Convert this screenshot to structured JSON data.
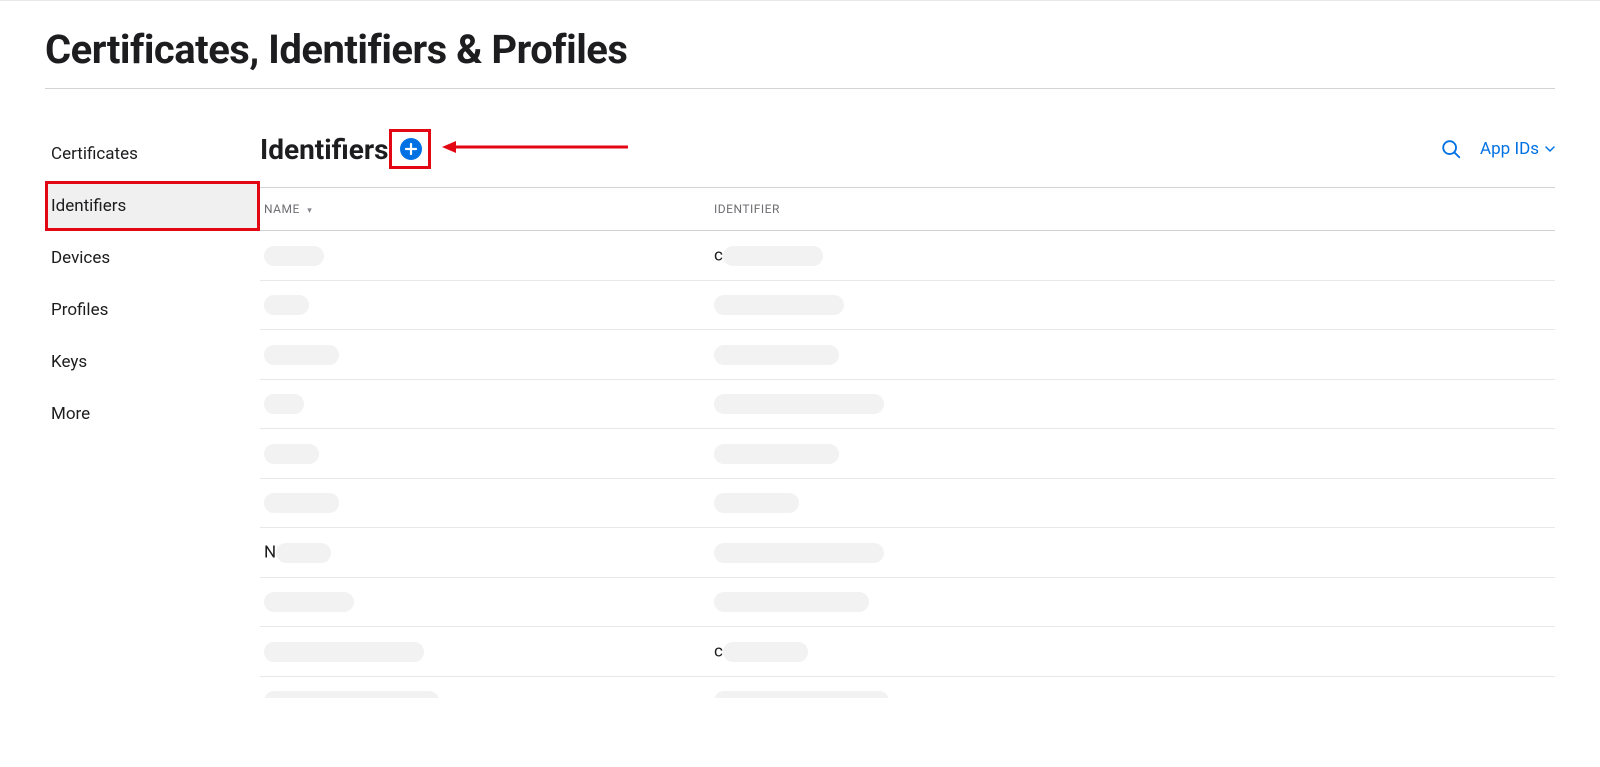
{
  "page_title": "Certificates, Identifiers & Profiles",
  "sidebar": {
    "items": [
      {
        "label": "Certificates",
        "active": false
      },
      {
        "label": "Identifiers",
        "active": true
      },
      {
        "label": "Devices",
        "active": false
      },
      {
        "label": "Profiles",
        "active": false
      },
      {
        "label": "Keys",
        "active": false
      },
      {
        "label": "More",
        "active": false
      }
    ]
  },
  "main": {
    "title": "Identifiers",
    "filter_label": "App IDs",
    "columns": {
      "name": "NAME",
      "identifier": "IDENTIFIER"
    },
    "rows": [
      {
        "name_prefix": "",
        "name_width": 60,
        "id_prefix": "c",
        "id_width": 100
      },
      {
        "name_prefix": "",
        "name_width": 45,
        "id_prefix": "",
        "id_width": 130
      },
      {
        "name_prefix": "",
        "name_width": 75,
        "id_prefix": "",
        "id_width": 125
      },
      {
        "name_prefix": "",
        "name_width": 40,
        "id_prefix": "",
        "id_width": 170
      },
      {
        "name_prefix": "",
        "name_width": 55,
        "id_prefix": "",
        "id_width": 125
      },
      {
        "name_prefix": "",
        "name_width": 75,
        "id_prefix": "",
        "id_width": 85
      },
      {
        "name_prefix": "N",
        "name_width": 55,
        "id_prefix": "",
        "id_width": 170
      },
      {
        "name_prefix": "",
        "name_width": 90,
        "id_prefix": "",
        "id_width": 155
      },
      {
        "name_prefix": "",
        "name_width": 160,
        "id_prefix": "c",
        "id_width": 85
      },
      {
        "name_prefix": "",
        "name_width": 175,
        "id_prefix": "",
        "id_width": 175
      }
    ]
  }
}
